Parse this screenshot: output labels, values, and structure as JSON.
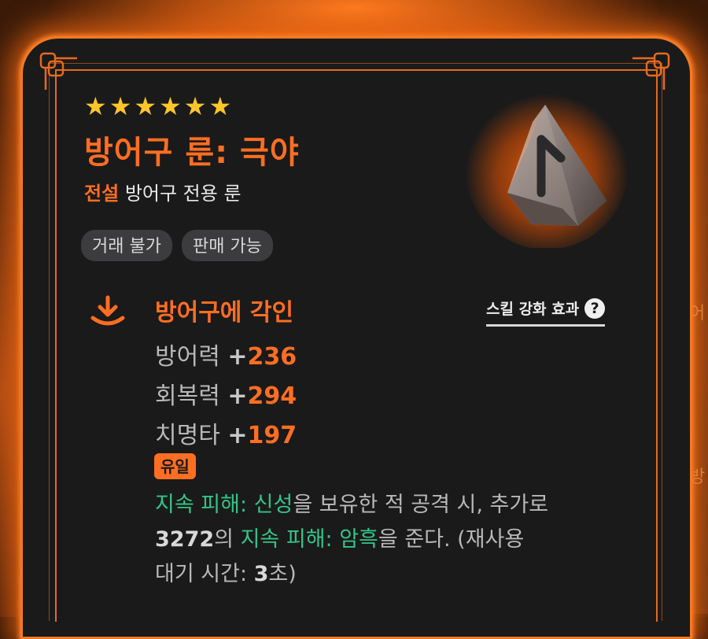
{
  "item": {
    "stars": 6,
    "title": "방어구 룬: 극야",
    "grade": "전설",
    "category": "방어구 전용 룬",
    "tags": [
      "거래 불가",
      "판매 가능"
    ]
  },
  "engrave": {
    "title": "방어구에 각인",
    "skill_link": "스킬 강화 효과",
    "help_symbol": "?"
  },
  "stats": [
    {
      "name": "방어력",
      "plus": "+",
      "value": "236"
    },
    {
      "name": "회복력",
      "plus": "+",
      "value": "294"
    },
    {
      "name": "치명타",
      "plus": "+",
      "value": "197"
    }
  ],
  "unique": {
    "badge": "유일",
    "line1_green": "지속 피해: 신성",
    "line1_rest": "을 보유한 적 공격 시, 추가로",
    "line2_num": "3272",
    "line2_a": "의 ",
    "line2_green": "지속 피해: 암흑",
    "line2_rest": "을 준다. (재사용",
    "line3_a": "대기 시간: ",
    "line3_num": "3",
    "line3_rest": "초)"
  },
  "side_ghost": [
    "어",
    "방",
    ":"
  ],
  "colors": {
    "accent": "#ff6e22",
    "star": "#ffc629",
    "green": "#33c48a",
    "card": "#1a1a1a"
  },
  "icons": [
    "star-icon",
    "knot-corner-icon",
    "rune-stone-icon",
    "engrave-download-icon",
    "help-icon"
  ]
}
